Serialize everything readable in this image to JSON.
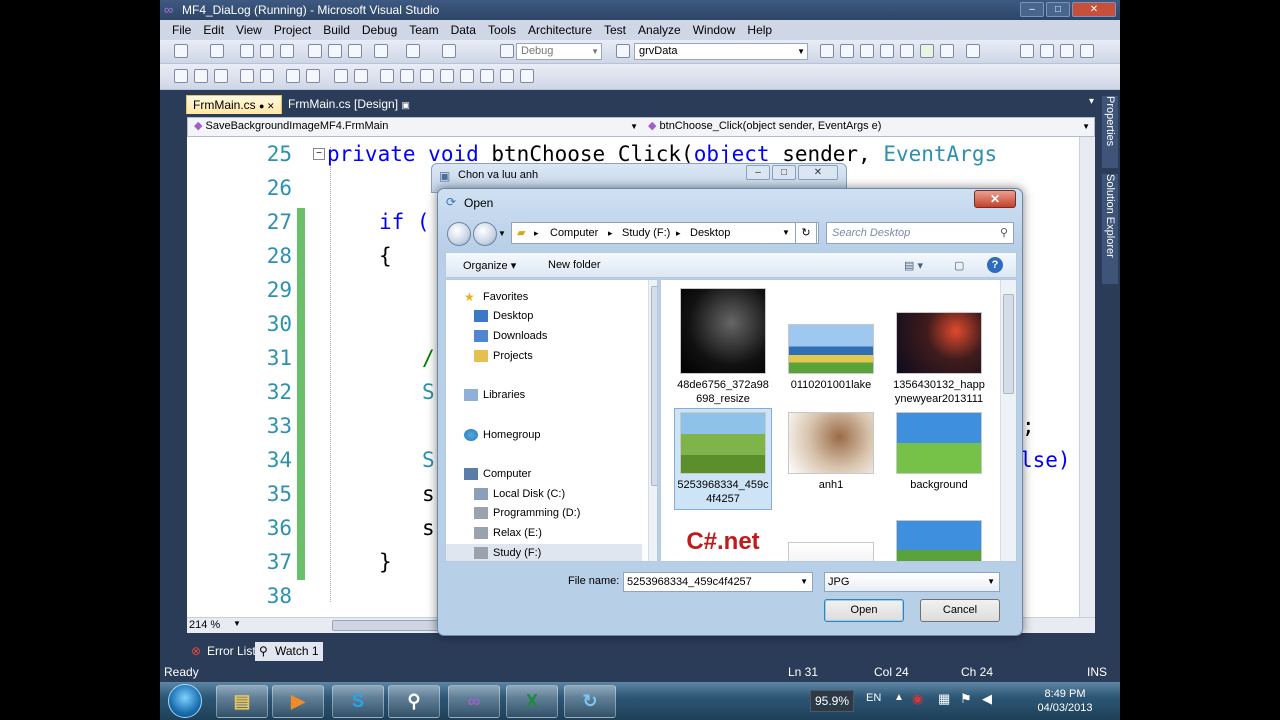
{
  "window": {
    "title": "MF4_DiaLog (Running) - Microsoft Visual Studio"
  },
  "menu": [
    "File",
    "Edit",
    "View",
    "Project",
    "Build",
    "Debug",
    "Team",
    "Data",
    "Tools",
    "Architecture",
    "Test",
    "Analyze",
    "Window",
    "Help"
  ],
  "toolbar": {
    "config": "Debug",
    "find_combo": "grvData"
  },
  "tabs": {
    "active": "FrmMain.cs",
    "other": "FrmMain.cs [Design]"
  },
  "navbar": {
    "class_combo": "SaveBackgroundImageMF4.FrmMain",
    "member_combo": "btnChoose_Click(object sender, EventArgs e)"
  },
  "code": {
    "line_numbers": [
      "25",
      "26",
      "27",
      "28",
      "29",
      "30",
      "31",
      "32",
      "33",
      "34",
      "35",
      "36",
      "37",
      "38"
    ],
    "line25": {
      "kw1": "private",
      "kw2": "void",
      "name": " btnChoose_Click(",
      "kw3": "object",
      "rest": " sender, ",
      "type": "EventArgs"
    },
    "line27_kw": "if (",
    "line28": "{",
    "line31_frag": "/",
    "line32_frag": "S",
    "line33_frag": ";",
    "line34_frag_left": "S",
    "line34_frag_right": "lse)",
    "line35_frag": "s",
    "line36_frag": "s",
    "line37": "}"
  },
  "zoom": "214 %",
  "bottom_tabs": [
    "Error List",
    "Watch 1"
  ],
  "status": {
    "ready": "Ready",
    "line": "Ln 31",
    "col": "Col 24",
    "ch": "Ch 24",
    "mode": "INS"
  },
  "side_tabs": [
    "Properties",
    "Solution Explorer"
  ],
  "outer_dialog": {
    "title": "Chon va luu anh"
  },
  "open_dialog": {
    "title": "Open",
    "close": "✕",
    "breadcrumbs": [
      "Computer",
      "Study (F:)",
      "Desktop"
    ],
    "search_placeholder": "Search Desktop",
    "organize": "Organize ▾",
    "new_folder": "New folder",
    "nav": {
      "favorites": "Favorites",
      "desktop": "Desktop",
      "downloads": "Downloads",
      "projects": "Projects",
      "libraries": "Libraries",
      "homegroup": "Homegroup",
      "computer": "Computer",
      "drive_c": "Local Disk (C:)",
      "drive_d": "Programming (D:)",
      "drive_e": "Relax (E:)",
      "drive_f": "Study (F:)"
    },
    "files": [
      {
        "name": "48de6756_372a98 698_resize"
      },
      {
        "name": "0110201001lake"
      },
      {
        "name": "1356430132_happ ynewyear2013111"
      },
      {
        "name": "5253968334_459c 4f4257"
      },
      {
        "name": "anh1"
      },
      {
        "name": "background"
      },
      {
        "name": "C#.net"
      }
    ],
    "file_name_label": "File name:",
    "file_name_value": "5253968334_459c4f4257",
    "file_type": "JPG",
    "open_btn": "Open",
    "cancel_btn": "Cancel"
  },
  "taskbar": {
    "cpu": "95.9%",
    "lang": "EN",
    "time": "8:49 PM",
    "date": "04/03/2013"
  },
  "colors": {
    "vs_frame": "#2b3c59",
    "keyword": "#0000ff",
    "type": "#2b91af",
    "linenum": "#2b91af",
    "changebar": "#6ac06a"
  }
}
